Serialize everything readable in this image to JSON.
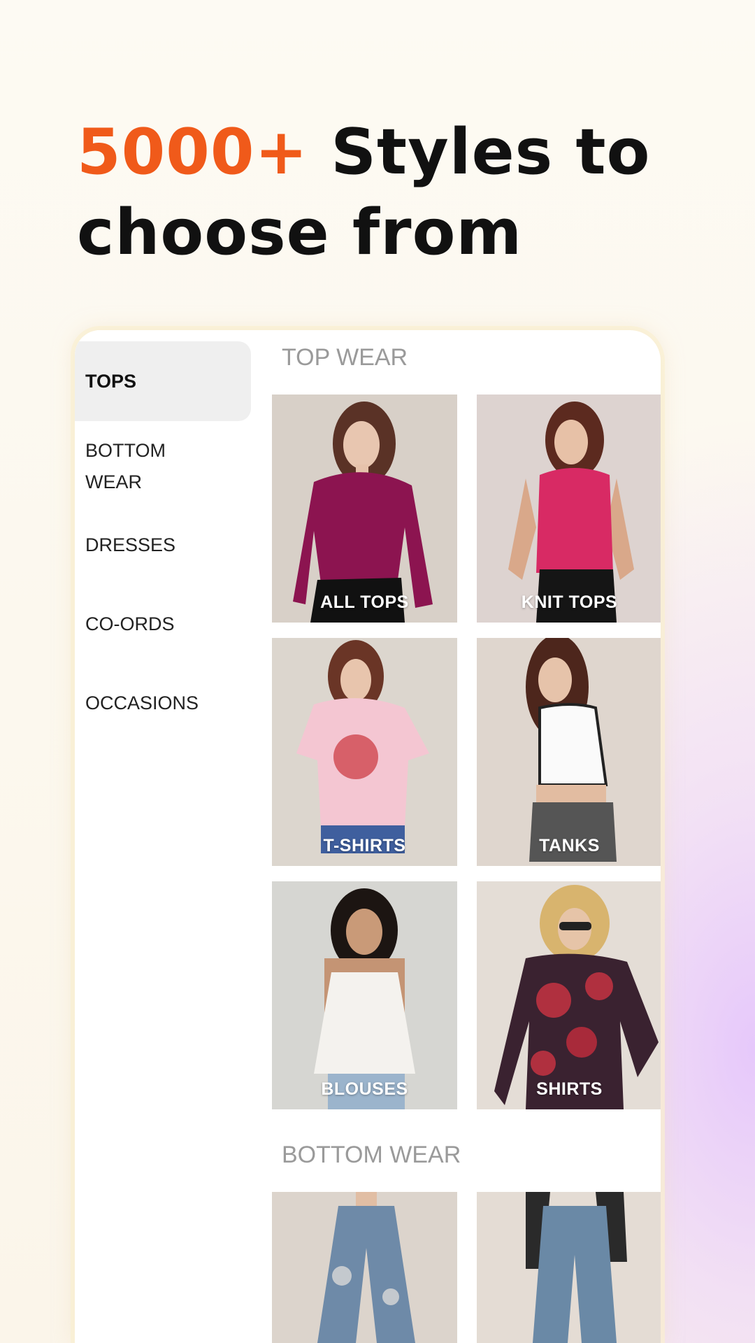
{
  "headline": {
    "accent": "5000+",
    "rest_line1": " Styles to",
    "line2": "choose from"
  },
  "sidebar": {
    "items": [
      {
        "label": "TOPS",
        "active": true
      },
      {
        "label": "BOTTOM\nWEAR",
        "line1": "BOTTOM",
        "line2": "WEAR"
      },
      {
        "label": "DRESSES"
      },
      {
        "label": "CO-ORDS"
      },
      {
        "label": "OCCASIONS"
      }
    ]
  },
  "sections": {
    "top_wear": {
      "title": "TOP WEAR",
      "tiles": [
        {
          "label": "ALL TOPS"
        },
        {
          "label": "KNIT TOPS"
        },
        {
          "label": "T-SHIRTS"
        },
        {
          "label": "TANKS"
        },
        {
          "label": "BLOUSES"
        },
        {
          "label": "SHIRTS"
        }
      ]
    },
    "bottom_wear": {
      "title": "BOTTOM WEAR"
    }
  },
  "colors": {
    "accent": "#f05a1a",
    "text": "#111111",
    "section_title": "#9a9a9a"
  }
}
